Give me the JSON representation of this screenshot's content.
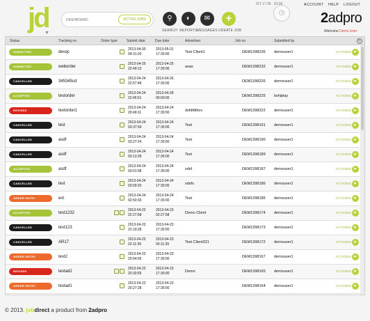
{
  "header": {
    "logo_text": "jd",
    "search_placeholder": "DASHBOARD",
    "search_active_label": "ACTIVE JOBS",
    "nav": [
      {
        "label": "SEARCH",
        "icon": "search-icon"
      },
      {
        "label": "REPORTS",
        "icon": "reports-icon"
      },
      {
        "label": "MESSAGES",
        "icon": "mail-icon"
      },
      {
        "label": "CREATE JOB",
        "icon": "plus-icon"
      }
    ],
    "clock": "IST 17:36 : 03:06",
    "top_links": [
      "ACCOUNT",
      "HELP",
      "LOGOUT"
    ],
    "brand_number": "2",
    "brand_name": "adpro",
    "welcome_text": "Welcome",
    "welcome_user": "Demo User"
  },
  "table": {
    "columns": [
      "Status",
      "Tracking no",
      "Order type",
      "Submit date",
      "Due date",
      "Advertiser",
      "Job no",
      "Submitted by"
    ],
    "actions_label": "ACTIONS",
    "rows": [
      {
        "status": "SUBMITTED",
        "color": "#a5c43a",
        "tracking": "devqc",
        "order_icons": 1,
        "submit": [
          "2013-04-30",
          "04:31:20"
        ],
        "due": [
          "2013-05-01",
          "17:30:00"
        ],
        "advertiser": "Test Client1",
        "job": "DEM1398236",
        "by": "demouser1"
      },
      {
        "status": "SUBMITTED",
        "color": "#a5c43a",
        "tracking": "weborder",
        "order_icons": 1,
        "submit": [
          "2013-04-25",
          "22:49:13"
        ],
        "due": [
          "2013-04-25",
          "17:30:00"
        ],
        "advertiser": "asas",
        "job": "DEM1398232",
        "by": "demouser1"
      },
      {
        "status": "CANCELLED",
        "color": "#1b1b1b",
        "tracking": "345345cd",
        "order_icons": 1,
        "submit": [
          "2013-04-24",
          "22:57:48"
        ],
        "due": [
          "2013-04-26",
          "17:30:00"
        ],
        "advertiser": "",
        "job": "DEM1398226",
        "by": "demouser1"
      },
      {
        "status": "ACCEPTED",
        "color": "#a5c43a",
        "tracking": "testorder",
        "order_icons": 1,
        "submit": [
          "2013-04-24",
          "22:45:51"
        ],
        "due": [
          "2013-04-28",
          "00:00:00"
        ],
        "advertiser": "",
        "job": "DEM1398225",
        "by": "bshiplay"
      },
      {
        "status": "REVISED",
        "color": "#d9261c",
        "tracking": "testorder1",
        "order_icons": 1,
        "submit": [
          "2013-04-24",
          "20:49:11"
        ],
        "due": [
          "2013-04-24",
          "17:30:00"
        ],
        "advertiser": "dsfdfdfdvv",
        "job": "DEM1398222",
        "by": "demouser1"
      },
      {
        "status": "CANCELLED",
        "color": "#1b1b1b",
        "tracking": "test",
        "order_icons": 1,
        "submit": [
          "2013-04-24",
          "03:37:59"
        ],
        "due": [
          "2013-04-24",
          "17:30:00"
        ],
        "advertiser": "Test",
        "job": "DEM1398191",
        "by": "demouser1"
      },
      {
        "status": "CANCELLED",
        "color": "#1b1b1b",
        "tracking": "asdf",
        "order_icons": 1,
        "submit": [
          "2013-04-24",
          "03:27:24"
        ],
        "due": [
          "2013-04-24",
          "17:30:00"
        ],
        "advertiser": "Test",
        "job": "DEM1398190",
        "by": "demouser1"
      },
      {
        "status": "CANCELLED",
        "color": "#1b1b1b",
        "tracking": "asdf",
        "order_icons": 1,
        "submit": [
          "2013-04-24",
          "03:13:39"
        ],
        "due": [
          "2013-04-24",
          "17:30:00"
        ],
        "advertiser": "Test",
        "job": "DEM1398189",
        "by": "demouser1"
      },
      {
        "status": "ACCEPTED",
        "color": "#a5c43a",
        "tracking": "asdf",
        "order_icons": 1,
        "submit": [
          "2013-04-24",
          "03:01:58"
        ],
        "due": [
          "2013-04-24",
          "17:30:00"
        ],
        "advertiser": "sdsf",
        "job": "DEM1398187",
        "by": "demouser1"
      },
      {
        "status": "CANCELLED",
        "color": "#1b1b1b",
        "tracking": "test",
        "order_icons": 1,
        "submit": [
          "2013-04-24",
          "03:00:20"
        ],
        "due": [
          "2013-04-24",
          "17:30:00"
        ],
        "advertiser": "sdsfs",
        "job": "DEM1398186",
        "by": "demouser1"
      },
      {
        "status": "ORDER ENTRY",
        "color": "#ec6a2c",
        "tracking": "est",
        "order_icons": 1,
        "submit": [
          "2013-04-24",
          "02:50:33"
        ],
        "due": [
          "2013-04-24",
          "17:30:00"
        ],
        "advertiser": "Test",
        "job": "DEM1398185",
        "by": "demouser1"
      },
      {
        "status": "ACCEPTED",
        "color": "#a5c43a",
        "tracking": "test1232",
        "order_icons": 2,
        "submit": [
          "2013-04-22",
          "22:27:58"
        ],
        "due": [
          "2013-04-23",
          "02:27:58"
        ],
        "advertiser": "Demo Client",
        "job": "DEM1398174",
        "by": "demouser1"
      },
      {
        "status": "CANCELLED",
        "color": "#1b1b1b",
        "tracking": "test123",
        "order_icons": 1,
        "submit": [
          "2013-04-22",
          "22:19:28"
        ],
        "due": [
          "2013-04-23",
          "17:30:00"
        ],
        "advertiser": "",
        "job": "DEM1398173",
        "by": "demouser1"
      },
      {
        "status": "CANCELLED",
        "color": "#1b1b1b",
        "tracking": "AR17",
        "order_icons": 1,
        "submit": [
          "2013-04-22",
          "22:11:39"
        ],
        "due": [
          "2013-04-23",
          "00:11:39"
        ],
        "advertiser": "Test Client321",
        "job": "DEM1398172",
        "by": "demouser1"
      },
      {
        "status": "ORDER ENTRY",
        "color": "#ec6a2c",
        "tracking": "test2",
        "order_icons": 1,
        "submit": [
          "2013-04-22",
          "20:54:55"
        ],
        "due": [
          "2013-04-23",
          "17:30:00"
        ],
        "advertiser": "",
        "job": "DEM1398167",
        "by": "demouser1"
      },
      {
        "status": "REVISED",
        "color": "#d9261c",
        "tracking": "testad2",
        "order_icons": 2,
        "submit": [
          "2013-04-22",
          "20:30:55"
        ],
        "due": [
          "2013-04-23",
          "17:30:00"
        ],
        "advertiser": "Demo",
        "job": "DEM1398165",
        "by": "demouser1"
      },
      {
        "status": "ORDER ENTRY",
        "color": "#ec6a2c",
        "tracking": "testad1",
        "order_icons": 1,
        "submit": [
          "2013-04-22",
          "20:27:28"
        ],
        "due": [
          "2013-04-23",
          "17:30:00"
        ],
        "advertiser": "",
        "job": "DEM1398164",
        "by": "demouser1"
      }
    ]
  },
  "footer": {
    "copyright": "© 2013.",
    "brand_job": "job",
    "brand_direct": "direct",
    "tagline": "a product from",
    "brand_number": "2",
    "brand_name": "adpro"
  },
  "colors": {
    "accent": "#b9d23a",
    "submitted": "#a5c43a",
    "cancelled": "#1b1b1b",
    "revised": "#d9261c",
    "order_entry": "#ec6a2c"
  }
}
